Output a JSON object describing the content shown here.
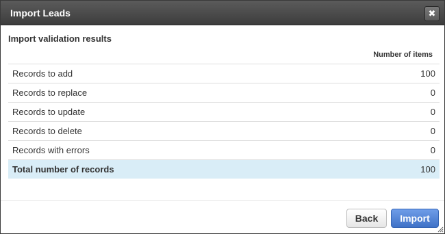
{
  "dialog": {
    "title": "Import Leads",
    "close_icon": "close-icon",
    "close_label": "✖"
  },
  "section": {
    "title": "Import validation results"
  },
  "table": {
    "header": "Number of items",
    "rows": [
      {
        "label": "Records to add",
        "value": "100"
      },
      {
        "label": "Records to replace",
        "value": "0"
      },
      {
        "label": "Records to update",
        "value": "0"
      },
      {
        "label": "Records to delete",
        "value": "0"
      },
      {
        "label": "Records with errors",
        "value": "0"
      }
    ],
    "total": {
      "label": "Total number of records",
      "value": "100"
    }
  },
  "footer": {
    "back_label": "Back",
    "import_label": "Import"
  },
  "colors": {
    "titlebar": "#4a4a4a",
    "total_row": "#d9edf7",
    "primary_button": "#4a7fd4"
  }
}
